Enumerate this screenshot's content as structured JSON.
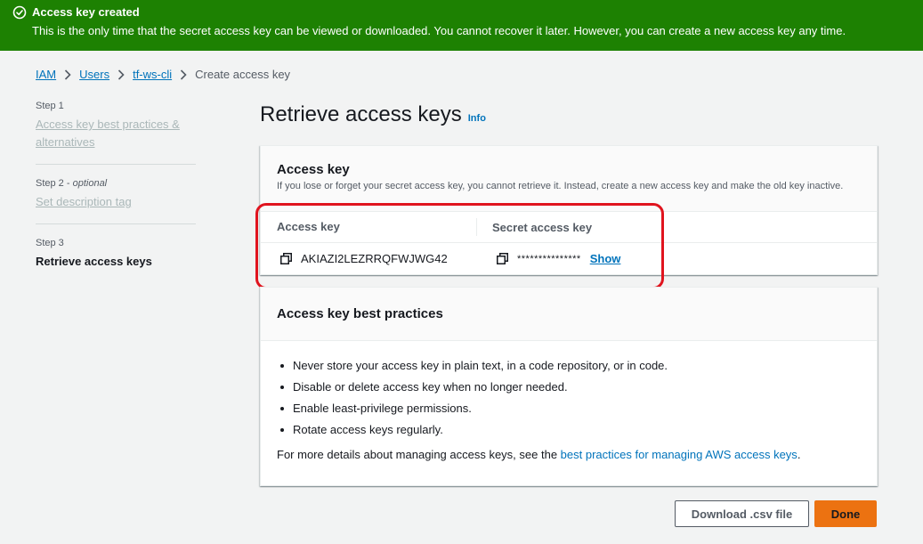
{
  "flash": {
    "title": "Access key created",
    "message": "This is the only time that the secret access key can be viewed or downloaded. You cannot recover it later. However, you can create a new access key any time.",
    "icon": "check-circle-icon",
    "color": "#1d8102"
  },
  "breadcrumb": {
    "items": [
      "IAM",
      "Users",
      "tf-ws-cli"
    ],
    "current": "Create access key"
  },
  "steps": [
    {
      "label": "Step 1",
      "title": "Access key best practices & alternatives"
    },
    {
      "label": "Step 2",
      "optional": "optional",
      "title": "Set description tag"
    },
    {
      "label": "Step 3",
      "title": "Retrieve access keys"
    }
  ],
  "page": {
    "title": "Retrieve access keys",
    "info": "Info"
  },
  "access_key_panel": {
    "title": "Access key",
    "description": "If you lose or forget your secret access key, you cannot retrieve it. Instead, create a new access key and make the old key inactive.",
    "col_access_key": "Access key",
    "col_secret_key": "Secret access key",
    "access_key_value": "AKIAZI2LEZRRQFWJWG42",
    "secret_masked": "***************",
    "show_label": "Show"
  },
  "best_practices": {
    "title": "Access key best practices",
    "items": [
      "Never store your access key in plain text, in a code repository, or in code.",
      "Disable or delete access key when no longer needed.",
      "Enable least-privilege permissions.",
      "Rotate access keys regularly."
    ],
    "more_prefix": "For more details about managing access keys, see the ",
    "more_link": "best practices for managing AWS access keys",
    "more_suffix": "."
  },
  "actions": {
    "download_csv": "Download .csv file",
    "done": "Done"
  },
  "colors": {
    "link": "#0073bb",
    "primary_button": "#ec7211",
    "highlight": "#e0141e"
  }
}
